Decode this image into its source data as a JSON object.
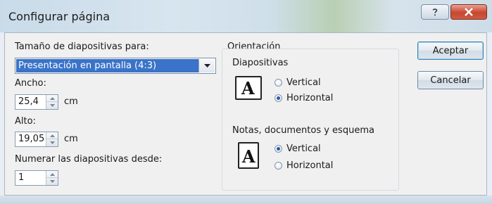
{
  "window": {
    "title": "Configurar página",
    "help_label": "?",
    "close_label": "✕"
  },
  "size_section": {
    "label": "Tamaño de diapositivas para:",
    "selected_option": "Presentación en pantalla (4:3)"
  },
  "width": {
    "label": "Ancho:",
    "value": "25,4",
    "unit": "cm"
  },
  "height": {
    "label": "Alto:",
    "value": "19,05",
    "unit": "cm"
  },
  "numbering": {
    "label": "Numerar las diapositivas desde:",
    "value": "1"
  },
  "orientation": {
    "label": "Orientación",
    "slides": {
      "label": "Diapositivas",
      "options": [
        "Vertical",
        "Horizontal"
      ],
      "selected": "Horizontal"
    },
    "notes": {
      "label": "Notas, documentos y esquema",
      "options": [
        "Vertical",
        "Horizontal"
      ],
      "selected": "Vertical"
    }
  },
  "buttons": {
    "ok": "Aceptar",
    "cancel": "Cancelar"
  },
  "colors": {
    "selection": "#3a73c8",
    "close_button": "#c7462f",
    "radio_dot": "#2a5aa8"
  }
}
